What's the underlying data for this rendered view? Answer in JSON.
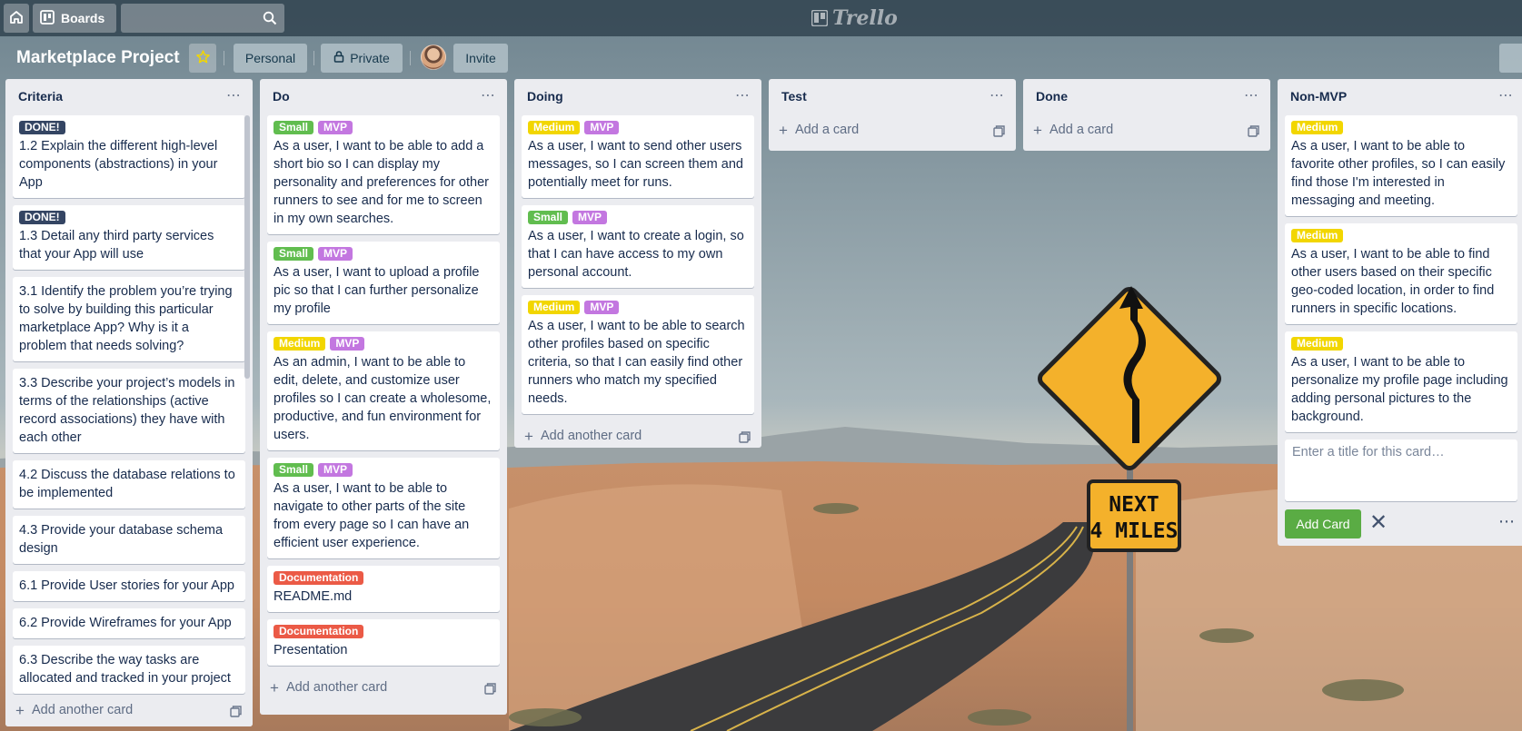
{
  "nav": {
    "home_icon": "home-icon",
    "boards_label": "Boards",
    "search_placeholder": "",
    "logo_text": "Trello"
  },
  "board": {
    "title": "Marketplace Project",
    "personal_label": "Personal",
    "private_label": "Private",
    "invite_label": "Invite"
  },
  "label_colors": {
    "DONE!": "#344563",
    "Small": "#61bd4f",
    "Medium": "#f2d600",
    "MVP": "#c377e0",
    "Documentation": "#eb5a46"
  },
  "lists": [
    {
      "title": "Criteria",
      "add_label": "Add another card",
      "cards": [
        {
          "labels": [
            "DONE!"
          ],
          "text": "1.2 Explain the different high-level components (abstractions) in your App"
        },
        {
          "labels": [
            "DONE!"
          ],
          "text": "1.3 Detail any third party services that your App will use"
        },
        {
          "labels": [],
          "text": "3.1 Identify the problem you’re trying to solve by building this particular marketplace App? Why is it a problem that needs solving?"
        },
        {
          "labels": [],
          "text": "3.3 Describe your project’s models in terms of the relationships (active record associations) they have with each other"
        },
        {
          "labels": [],
          "text": "4.2 Discuss the database relations to be implemented"
        },
        {
          "labels": [],
          "text": "4.3 Provide your database schema design"
        },
        {
          "labels": [],
          "text": "6.1 Provide User stories for your App"
        },
        {
          "labels": [],
          "text": "6.2 Provide Wireframes for your App"
        },
        {
          "labels": [],
          "text": "6.3 Describe the way tasks are allocated and tracked in your project"
        }
      ]
    },
    {
      "title": "Do",
      "add_label": "Add another card",
      "cards": [
        {
          "labels": [
            "Small",
            "MVP"
          ],
          "text": "As a user, I want to be able to add a short bio so I can display my personality and preferences for other runners to see and for me to screen in my own searches."
        },
        {
          "labels": [
            "Small",
            "MVP"
          ],
          "text": "As a user, I want to upload a profile pic so that I can further personalize my profile"
        },
        {
          "labels": [
            "Medium",
            "MVP"
          ],
          "text": "As an admin, I want to be able to edit, delete, and customize user profiles so I can create a wholesome, productive, and fun environment for users."
        },
        {
          "labels": [
            "Small",
            "MVP"
          ],
          "text": "As a user, I want to be able to navigate to other parts of the site from every page so I can have an efficient user experience."
        },
        {
          "labels": [
            "Documentation"
          ],
          "text": "README.md"
        },
        {
          "labels": [
            "Documentation"
          ],
          "text": "Presentation"
        }
      ]
    },
    {
      "title": "Doing",
      "add_label": "Add another card",
      "cards": [
        {
          "labels": [
            "Medium",
            "MVP"
          ],
          "text": "As a user, I want to send other users messages, so I can screen them and potentially meet for runs."
        },
        {
          "labels": [
            "Small",
            "MVP"
          ],
          "text": "As a user, I want to create a login, so that I can have access to my own personal account."
        },
        {
          "labels": [
            "Medium",
            "MVP"
          ],
          "text": "As a user, I want to be able to search other profiles based on specific criteria, so that I can easily find other runners who match my specified needs."
        }
      ]
    },
    {
      "title": "Test",
      "add_label": "Add a card",
      "cards": []
    },
    {
      "title": "Done",
      "add_label": "Add a card",
      "cards": []
    },
    {
      "title": "Non-MVP",
      "add_label": "",
      "cards": [
        {
          "labels": [
            "Medium"
          ],
          "text": "As a user, I want to be able to favorite other profiles, so I can easily find those I'm interested in messaging and meeting."
        },
        {
          "labels": [
            "Medium"
          ],
          "text": "As a user, I want to be able to find other users based on their specific geo-coded location, in order to find runners in specific locations."
        },
        {
          "labels": [
            "Medium"
          ],
          "text": "As a user, I want to be able to personalize my profile page including adding personal pictures to the background."
        }
      ],
      "composer": {
        "placeholder": "Enter a title for this card…",
        "submit_label": "Add Card"
      }
    }
  ],
  "background": {
    "sign_text_line1": "NEXT",
    "sign_text_line2": "4 MILES"
  }
}
